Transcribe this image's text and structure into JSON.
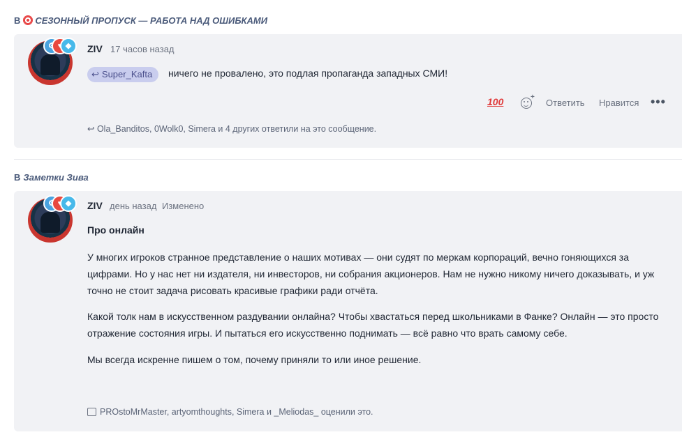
{
  "threads": [
    {
      "prefix": "В",
      "title": "СЕЗОННЫЙ ПРОПУСК — РАБОТА НАД ОШИБКАМИ",
      "icon": "target-icon",
      "post": {
        "author": "ZIV",
        "time": "17 часов назад",
        "quote_user": "Super_Kafta",
        "text": "ничего не провалено, это подлая пропаганда западных СМИ!",
        "reaction": "💯",
        "reply_label": "Ответить",
        "like_label": "Нравится",
        "more_label": "•••",
        "replies_text": "Ola_Banditos, 0Wolk0, Simera и 4 других ответили на это сообщение."
      }
    },
    {
      "prefix": "В",
      "title": "Заметки Зива",
      "post": {
        "author": "ZIV",
        "time": "день назад",
        "edited": "Изменено",
        "heading": "Про онлайн",
        "paragraphs": [
          "У многих игроков странное представление о наших мотивах — они судят по меркам корпораций, вечно гоняющихся за",
          "цифрами. Но у нас нет ни издателя, ни инвесторов, ни собрания акционеров. Нам не нужно никому ничего доказывать, и уж",
          "точно не стоит задача рисовать красивые графики ради отчёта.",
          "Какой толк нам в искусственном раздувании онлайна? Чтобы хвастаться перед школьниками в Фанке? Онлайн — это просто",
          "отражение состояния игры. И пытаться его искусственно поднимать — всё равно что врать самому себе.",
          "Мы всегда искренне пишем о том, почему приняли то или иное решение."
        ],
        "likes_text": "PROstoMrMaster, artyomthoughts, Simera и _Meliodas_ оценили это."
      }
    }
  ],
  "colors": {
    "accent": "#4a4f8c",
    "pill_bg": "#c9cdee",
    "card_bg": "#f1f2f5",
    "section": "#4a5a7a"
  }
}
